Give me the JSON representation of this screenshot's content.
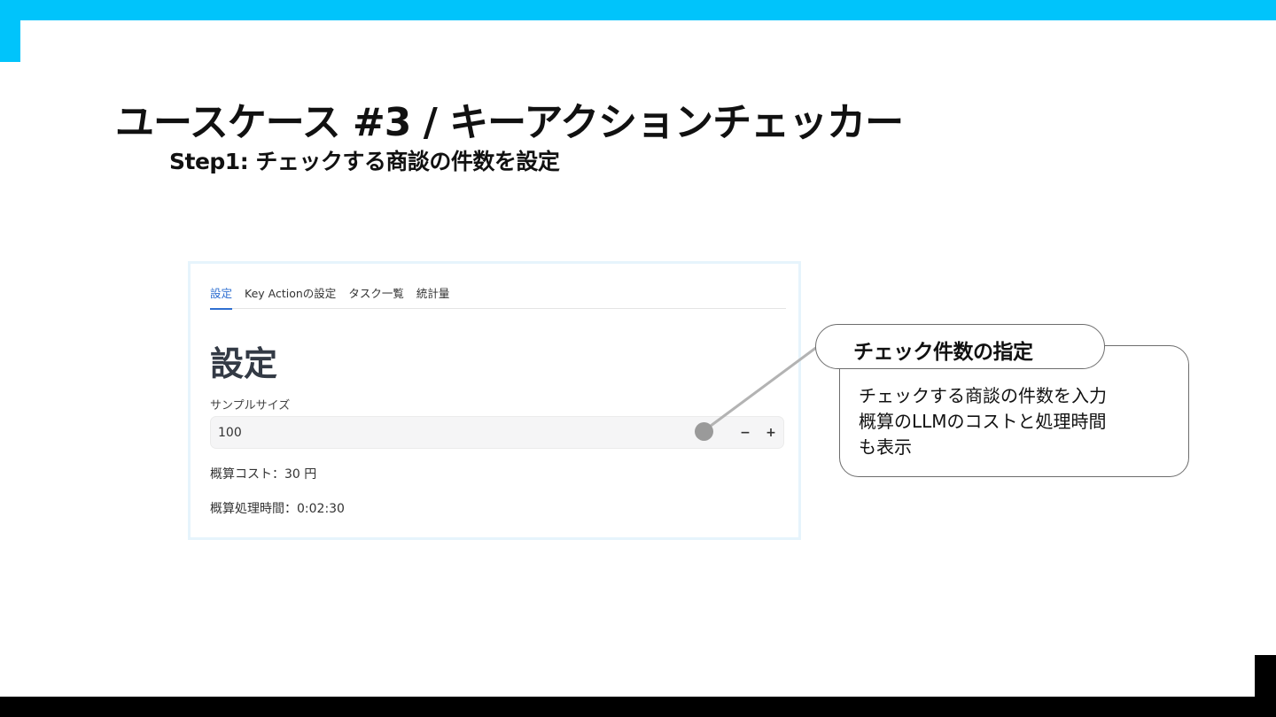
{
  "slide": {
    "title": "ユースケース  #3 / キーアクションチェッカー",
    "subtitle": "Step1: チェックする商談の件数を設定"
  },
  "app": {
    "tabs": [
      {
        "label": "設定",
        "active": true
      },
      {
        "label": "Key Actionの設定",
        "active": false
      },
      {
        "label": "タスク一覧",
        "active": false
      },
      {
        "label": "統計量",
        "active": false
      }
    ],
    "heading": "設定",
    "sample_size": {
      "label": "サンプルサイズ",
      "value": "100",
      "decrement_label": "−",
      "increment_label": "+"
    },
    "estimated_cost": "概算コスト：30 円",
    "estimated_time": "概算処理時間：0:02:30"
  },
  "callout": {
    "title": "チェック件数の指定",
    "lines": [
      "チェックする商談の件数を入力",
      "概算のLLMのコストと処理時間",
      "も表示"
    ]
  },
  "colors": {
    "accent": "#00c4fb",
    "tab_active": "#2f6fd1",
    "marker": "#9a9a9a"
  }
}
